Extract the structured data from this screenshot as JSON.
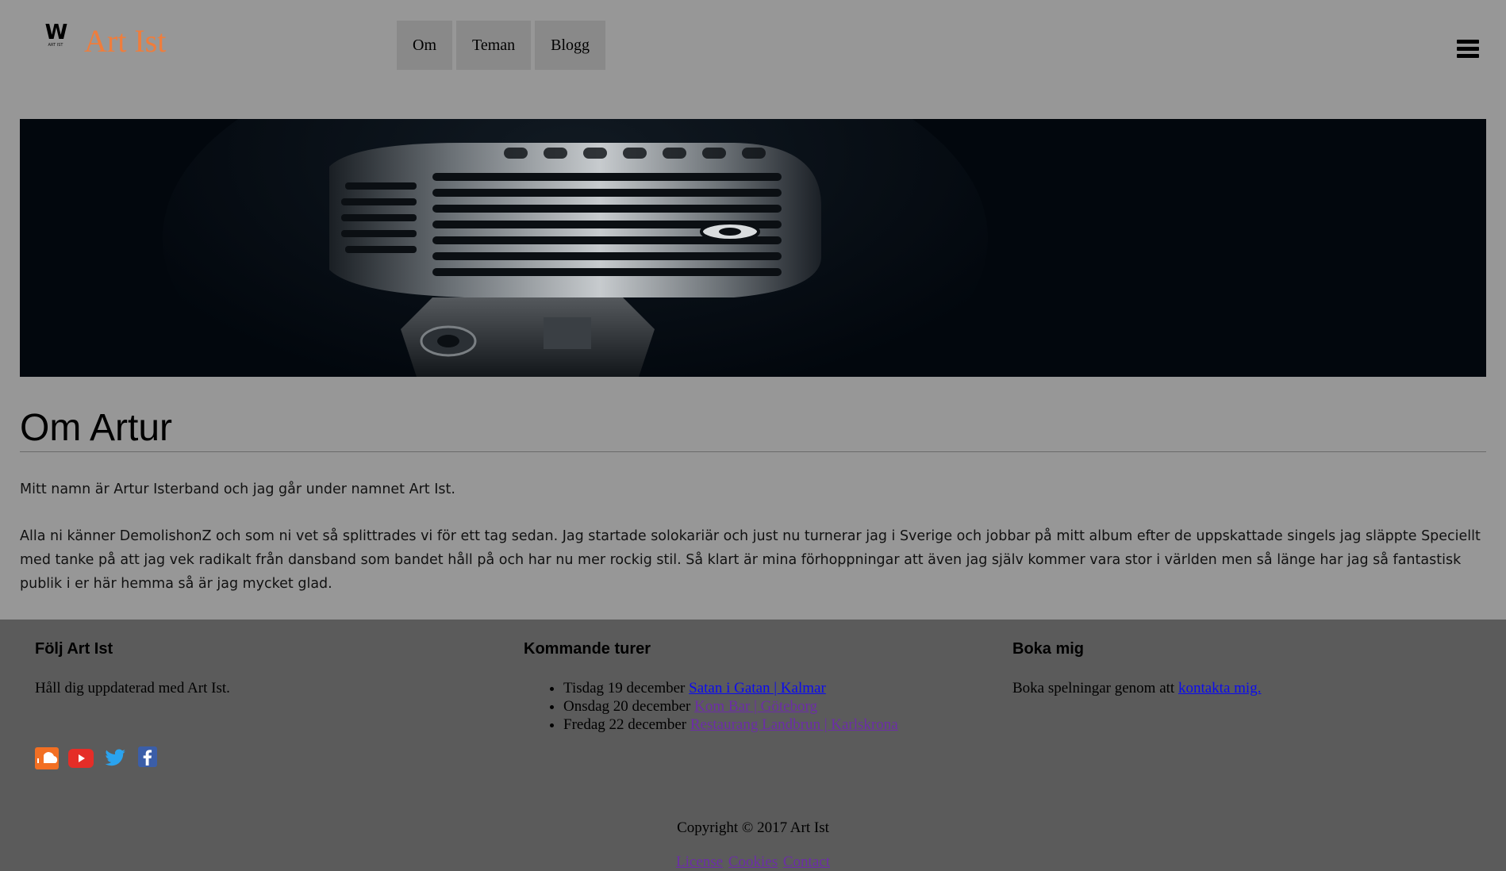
{
  "header": {
    "logo_letter": "W",
    "logo_subtext": "ART IST",
    "site_title": "Art Ist",
    "nav": [
      "Om",
      "Teman",
      "Blogg"
    ],
    "menu_icon": "hamburger-menu-icon"
  },
  "hero": {
    "image": "vintage-microphone-photo"
  },
  "main": {
    "title": "Om Artur",
    "paragraphs": [
      "Mitt namn är Artur Isterband och jag går under namnet Art Ist.",
      "Alla ni känner DemolishonZ och som ni vet så splittrades vi för ett tag sedan. Jag startade solokariär och just nu turnerar jag i Sverige och jobbar på mitt album efter de uppskattade singels jag släppte Speciellt med tanke på att jag vek radikalt från dansband som bandet håll på och har nu mer rockig stil. Så klart är mina förhoppningar att även jag själv kommer vara stor i världen men så länge har jag så fantastisk publik i er här hemma så är jag mycket glad."
    ]
  },
  "footer": {
    "follow": {
      "title": "Följ Art Ist",
      "text": "Håll dig uppdaterad med Art Ist.",
      "social": [
        "soundcloud-icon",
        "youtube-icon",
        "twitter-icon",
        "facebook-icon"
      ]
    },
    "tours": {
      "title": "Kommande turer",
      "items": [
        {
          "date": "Tisdag 19 december",
          "venue": "Satan i Gatan | Kalmar"
        },
        {
          "date": "Onsdag 20 december",
          "venue": "Kom Bar | Göteborg"
        },
        {
          "date": "Fredag 22 december",
          "venue": "Restaurang Landbrun | Karlskrona"
        }
      ]
    },
    "booking": {
      "title": "Boka mig",
      "text": "Boka spelningar genom att",
      "link": "kontakta mig."
    },
    "copyright": "Copyright © 2017 Art Ist",
    "links": [
      "License",
      "Cookies",
      "Contact"
    ]
  },
  "colors": {
    "page_bg": "#979797",
    "footer_bg": "#5b5b5b",
    "title_accent": "#ef7d3c",
    "link": "#0b0bee",
    "visited_link": "#6c2da8"
  }
}
